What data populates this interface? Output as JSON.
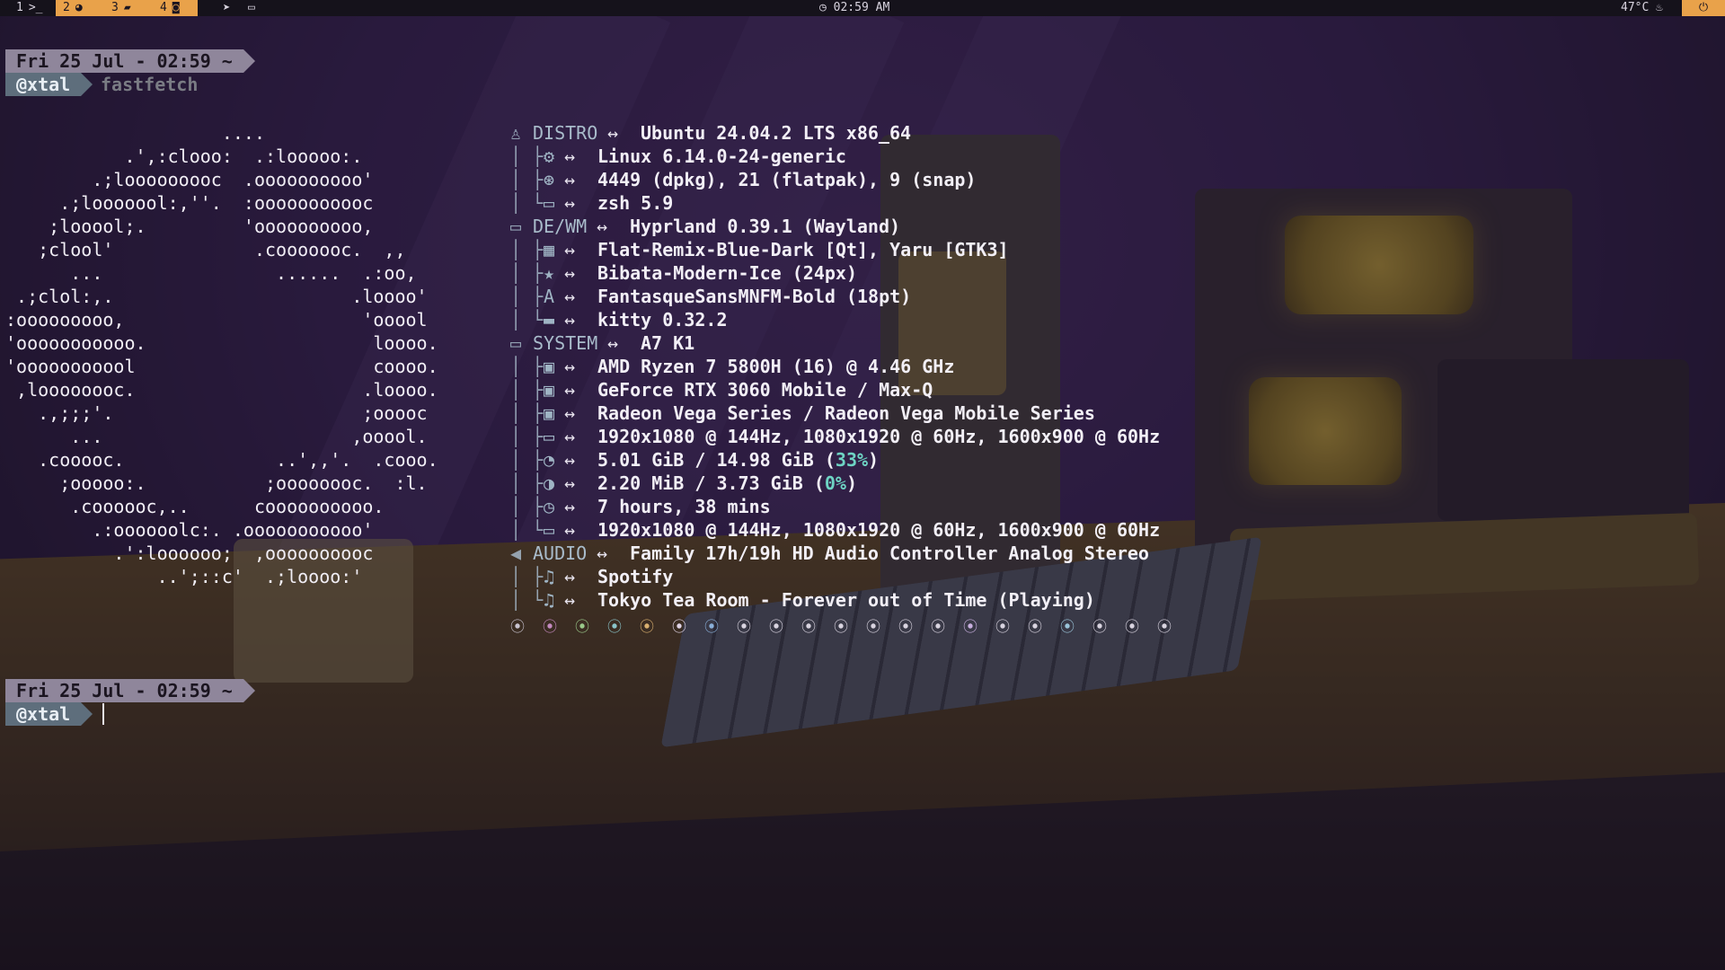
{
  "topbar": {
    "workspaces": [
      {
        "num": "1",
        "icon": ">_",
        "active": false
      },
      {
        "num": "2",
        "icon": "◕",
        "active": true
      },
      {
        "num": "3",
        "icon": "▰",
        "active": true
      },
      {
        "num": "4",
        "icon": "◙",
        "active": true
      }
    ],
    "tray_icons": [
      "telegram-icon",
      "window-icon"
    ],
    "clock": "02:59 AM",
    "temperature": "47°C",
    "accent_color": "#e9a24a"
  },
  "terminal": {
    "prompt1": {
      "date": "Fri 25 Jul - 02:59  ~",
      "user": "@xtal",
      "command": "fastfetch"
    },
    "prompt2": {
      "date": "Fri 25 Jul - 02:59  ~",
      "user": "@xtal"
    },
    "ascii_art": "                    ....\n           .',:clooo:  .:looooo:.\n        .;looooooooc  .oooooooooo'\n     .;looooool:,''.  :ooooooooooc\n    ;looool;.         'oooooooooo,\n   ;clool'             .cooooooc.  ,,\n      ...                ......  .:oo,\n .;clol:,.                      .loooo'\n:ooooooooo,                      'ooool\n'ooooooooooo.                     loooo.\n'ooooooooool                      coooo.\n ,loooooooc.                     .loooo.\n   .,;;;'.                       ;ooooc\n      ...                       ,ooool.\n   .cooooc.              ..',,'.  .cooo.\n     ;ooooo:.           ;oooooooc.  :l.\n      .coooooc,..      coooooooooo.\n        .:oooooolc:. .ooooooooooo'\n          .':loooooo;  ,oooooooooc\n              ..';::c'  .;loooo:'",
    "info": {
      "distro": {
        "label": "DISTRO",
        "value": "Ubuntu 24.04.2 LTS x86_64"
      },
      "distro_items": [
        {
          "icon": "gear-icon",
          "glyph": "⚙",
          "value": "Linux 6.14.0-24-generic"
        },
        {
          "icon": "package-icon",
          "glyph": "⊛",
          "value": "4449 (dpkg), 21 (flatpak), 9 (snap)"
        },
        {
          "icon": "shell-icon",
          "glyph": "▭",
          "value": "zsh 5.9"
        }
      ],
      "dewm": {
        "label": "DE/WM",
        "value": "Hyprland 0.39.1 (Wayland)"
      },
      "dewm_items": [
        {
          "icon": "theme-icon",
          "glyph": "▦",
          "value": "Flat-Remix-Blue-Dark [Qt], Yaru [GTK3]"
        },
        {
          "icon": "cursor-icon",
          "glyph": "★",
          "value": "Bibata-Modern-Ice (24px)"
        },
        {
          "icon": "font-icon",
          "glyph": "A",
          "value": "FantasqueSansMNFM-Bold (18pt)"
        },
        {
          "icon": "terminal-icon",
          "glyph": "▬",
          "value": "kitty 0.32.2"
        }
      ],
      "system": {
        "label": "SYSTEM",
        "value": "A7 K1"
      },
      "system_items": [
        {
          "icon": "cpu-icon",
          "glyph": "▣",
          "value": "AMD Ryzen 7 5800H (16) @ 4.46 GHz"
        },
        {
          "icon": "gpu-icon",
          "glyph": "▣",
          "value": "GeForce RTX 3060 Mobile / Max-Q"
        },
        {
          "icon": "gpu-icon",
          "glyph": "▣",
          "value": "Radeon Vega Series / Radeon Vega Mobile Series"
        },
        {
          "icon": "monitor-icon",
          "glyph": "▭",
          "value": "1920x1080 @ 144Hz, 1080x1920 @ 60Hz, 1600x900 @ 60Hz"
        },
        {
          "icon": "memory-icon",
          "glyph": "◔",
          "value_pre": "5.01 GiB / 14.98 GiB (",
          "value_pct": "33%",
          "value_post": ")"
        },
        {
          "icon": "disk-icon",
          "glyph": "◑",
          "value_pre": "2.20 MiB / 3.73 GiB (",
          "value_pct": "0%",
          "value_post": ")"
        },
        {
          "icon": "uptime-icon",
          "glyph": "◷",
          "value": "7 hours, 38 mins"
        },
        {
          "icon": "monitor-icon",
          "glyph": "▭",
          "value": "1920x1080 @ 144Hz, 1080x1920 @ 60Hz, 1600x900 @ 60Hz"
        }
      ],
      "audio": {
        "label": "AUDIO",
        "value": "Family 17h/19h HD Audio Controller Analog Stereo"
      },
      "audio_items": [
        {
          "icon": "player-icon",
          "glyph": "♫",
          "value": "Spotify"
        },
        {
          "icon": "music-icon",
          "glyph": "♫",
          "value": "Tokyo Tea Room - Forever out of Time (Playing)"
        }
      ],
      "arrow": "↔",
      "tree_colors": [
        "#a4b7c7"
      ],
      "percent_color": "#6ed4c4"
    },
    "color_dots": [
      "⦿",
      "⦿",
      "⦿",
      "⦿",
      "⦿",
      "⦿",
      "⦿",
      "⦿",
      "⦿",
      "⦿",
      "⦿",
      "⦿",
      "⦿",
      "⦿",
      "⦿",
      "⦿",
      "⦿",
      "⦿",
      "⦿",
      "⦿",
      "⦿"
    ]
  }
}
